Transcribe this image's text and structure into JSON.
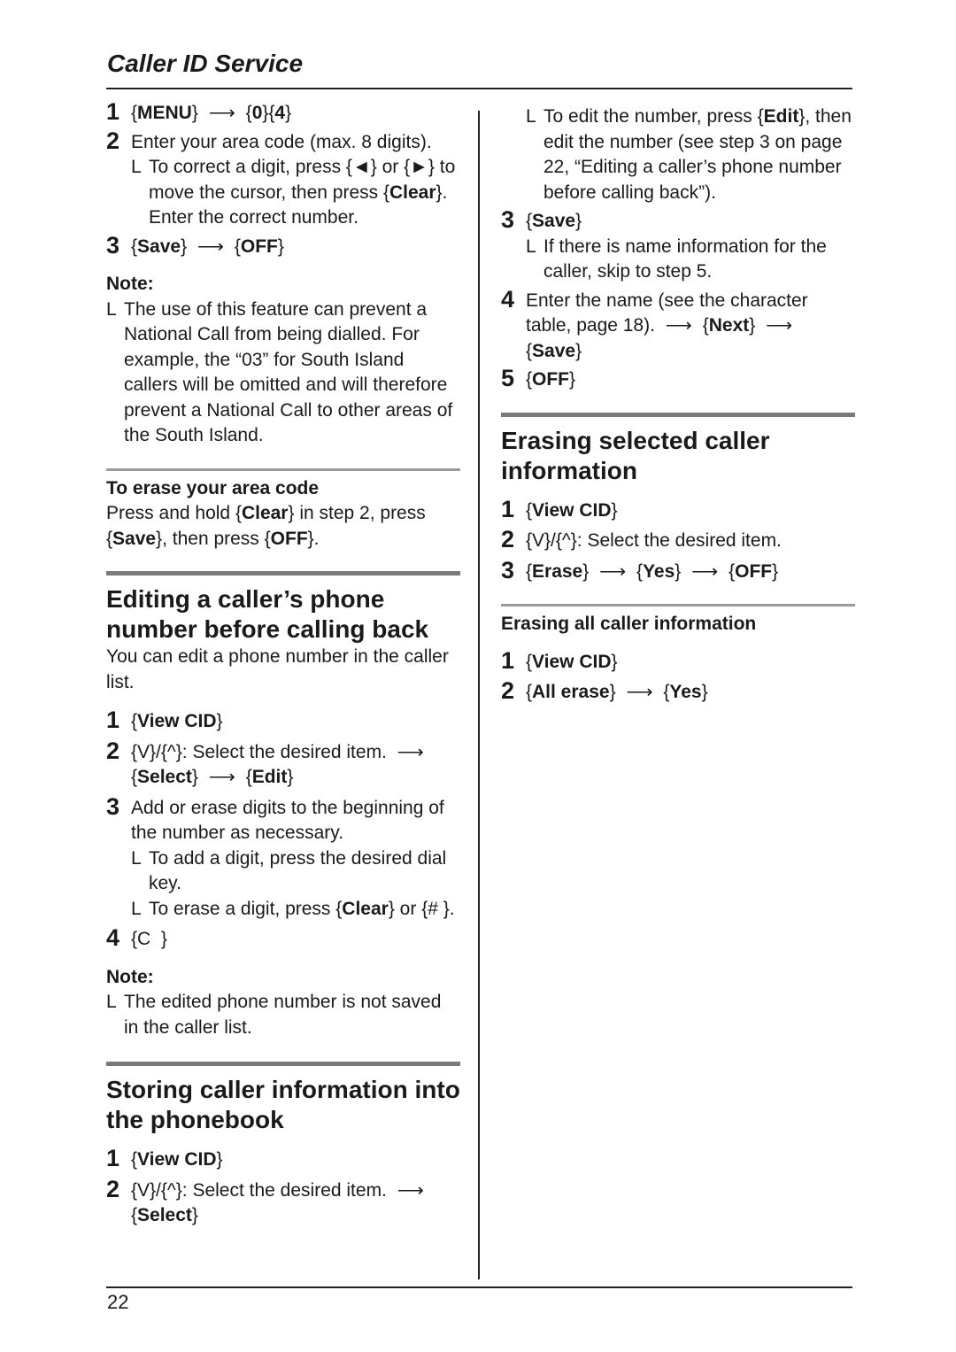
{
  "header": {
    "title": "Caller ID Service"
  },
  "footer": {
    "page_number": "22"
  },
  "glyphs": {
    "arrow": "⟶",
    "bullet": "L",
    "lbrace": "{",
    "rbrace": "}"
  },
  "left": {
    "setup_steps": [
      {
        "num": "1",
        "key1": "MENU",
        "key2": "0",
        "key3": "4"
      },
      {
        "num": "2",
        "text": "Enter your area code (max. 8 digits).",
        "sub": {
          "pre": "To correct a digit, press ",
          "key_left": "◄",
          "mid": " or ",
          "key_right": "►",
          "post1": " to move the cursor, then press ",
          "key": "Clear",
          "post2": ". Enter the correct number."
        }
      },
      {
        "num": "3",
        "key1": "Save",
        "key2": "OFF"
      }
    ],
    "note1": {
      "label": "Note:",
      "text": "The use of this feature can prevent a National Call from being dialled. For example, the “03” for South Island callers will be omitted and will therefore prevent a National Call to other areas of the South Island."
    },
    "erase_area": {
      "heading": "To erase your area code",
      "pre": "Press and hold ",
      "key1": "Clear",
      "mid1": " in step 2, press ",
      "key2": "Save",
      "mid2": ", then press ",
      "key3": "OFF",
      "post": "."
    },
    "editing": {
      "heading": "Editing a caller’s phone number before calling back",
      "intro": "You can edit a phone number in the caller list.",
      "step1": {
        "num": "1",
        "key": "View CID"
      },
      "step2": {
        "num": "2",
        "key_down": "V",
        "key_up": "^",
        "text": ": Select the desired item.",
        "key_select": "Select",
        "key_edit": "Edit"
      },
      "step3": {
        "num": "3",
        "text": "Add or erase digits to the beginning of the number as necessary.",
        "sub1": "To add a digit, press the desired dial key.",
        "sub2_pre": "To erase a digit, press ",
        "sub2_key": "Clear",
        "sub2_mid": " or ",
        "sub2_key2": "# ",
        "sub2_post": "."
      },
      "step4": {
        "num": "4",
        "key": "C  "
      },
      "note_label": "Note:",
      "note_text": "The edited phone number is not saved in the caller list."
    },
    "storing": {
      "heading": "Storing caller information into the phonebook",
      "step1": {
        "num": "1",
        "key": "View CID"
      },
      "step2": {
        "num": "2",
        "key_down": "V",
        "key_up": "^",
        "text": ": Select the desired item.",
        "key_select": "Select"
      }
    }
  },
  "right": {
    "edit_sub": {
      "pre": "To edit the number, press ",
      "key": "Edit",
      "post": ", then edit the number (see step 3 on page 22, “Editing a caller’s phone number before calling back”)."
    },
    "step3": {
      "num": "3",
      "key": "Save",
      "sub": "If there is name information for the caller, skip to step 5."
    },
    "step4": {
      "num": "4",
      "text": "Enter the name (see the character table, page 18).",
      "key1": "Next",
      "key2": "Save"
    },
    "step5": {
      "num": "5",
      "key": "OFF"
    },
    "erasing_selected": {
      "heading": "Erasing selected caller information",
      "step1": {
        "num": "1",
        "key": "View CID"
      },
      "step2": {
        "num": "2",
        "key_down": "V",
        "key_up": "^",
        "text": ": Select the desired item."
      },
      "step3": {
        "num": "3",
        "key1": "Erase",
        "key2": "Yes",
        "key3": "OFF"
      }
    },
    "erasing_all": {
      "heading": "Erasing all caller information",
      "step1": {
        "num": "1",
        "key": "View CID"
      },
      "step2": {
        "num": "2",
        "key1": "All erase",
        "key2": "Yes"
      }
    }
  }
}
